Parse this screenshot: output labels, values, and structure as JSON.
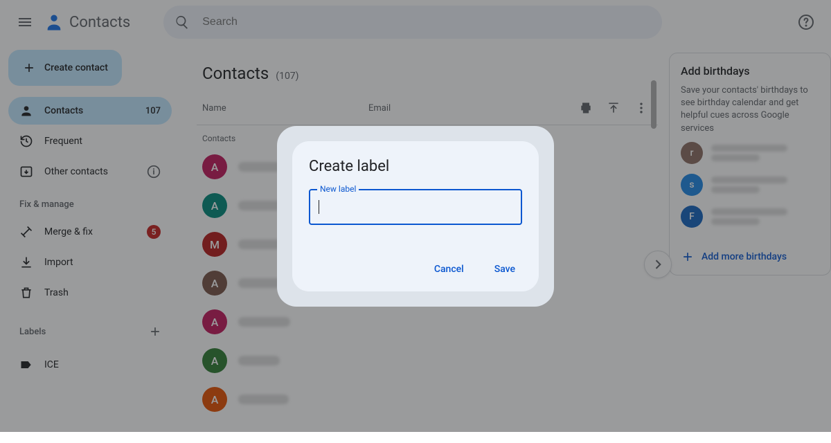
{
  "app": {
    "name": "Contacts"
  },
  "search": {
    "placeholder": "Search"
  },
  "sidebar": {
    "create_label": "Create contact",
    "items": [
      {
        "label": "Contacts",
        "count": "107"
      },
      {
        "label": "Frequent"
      },
      {
        "label": "Other contacts"
      }
    ],
    "manage_section": "Fix & manage",
    "manage": [
      {
        "label": "Merge & fix",
        "badge": "5"
      },
      {
        "label": "Import"
      },
      {
        "label": "Trash"
      }
    ],
    "labels_section": "Labels",
    "labels": [
      {
        "label": "ICE"
      }
    ]
  },
  "main": {
    "title": "Contacts",
    "count": "(107)",
    "columns": {
      "name": "Name",
      "email": "Email"
    },
    "section": "Contacts",
    "rows": [
      {
        "initial": "A",
        "color": "#c2185b"
      },
      {
        "initial": "A",
        "color": "#00897b"
      },
      {
        "initial": "M",
        "color": "#b71c1c"
      },
      {
        "initial": "A",
        "color": "#795548"
      },
      {
        "initial": "A",
        "color": "#c2185b"
      },
      {
        "initial": "A",
        "color": "#2e7d32"
      },
      {
        "initial": "A",
        "color": "#e65100"
      }
    ]
  },
  "right": {
    "title": "Add birthdays",
    "body": "Save your contacts' birthdays to see birthday calendar and get helpful cues across Google services",
    "suggestions": [
      {
        "initial": "r",
        "color": "#8d6e63"
      },
      {
        "initial": "s",
        "color": "#1e88e5"
      },
      {
        "initial": "F",
        "color": "#1565c0"
      }
    ],
    "add_more": "Add more birthdays"
  },
  "modal": {
    "title": "Create label",
    "field_label": "New label",
    "value": "",
    "cancel": "Cancel",
    "save": "Save"
  }
}
